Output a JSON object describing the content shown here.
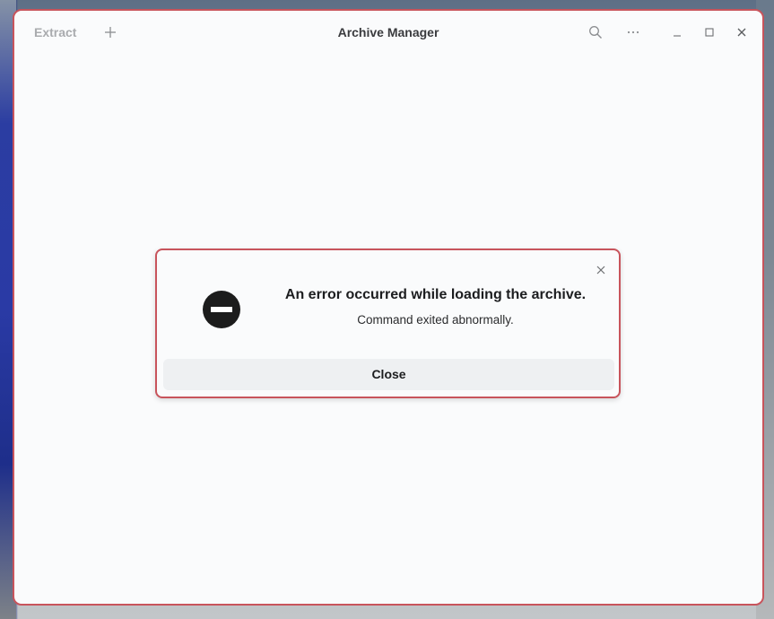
{
  "window": {
    "title": "Archive Manager",
    "extract_label": "Extract"
  },
  "titlebar_icons": {
    "add": "plus-icon",
    "search": "search-icon",
    "menu": "more-horizontal-icon",
    "minimize": "minimize-icon",
    "maximize": "maximize-icon",
    "close": "close-icon"
  },
  "dialog": {
    "icon": "error-stop-icon",
    "heading": "An error occurred while loading the archive.",
    "message": "Command exited abnormally.",
    "button_label": "Close"
  },
  "colors": {
    "accent_border": "#c8545c",
    "window_bg": "#fafbfc",
    "button_bg": "#eef0f2",
    "error_icon": "#1c1c1c"
  }
}
